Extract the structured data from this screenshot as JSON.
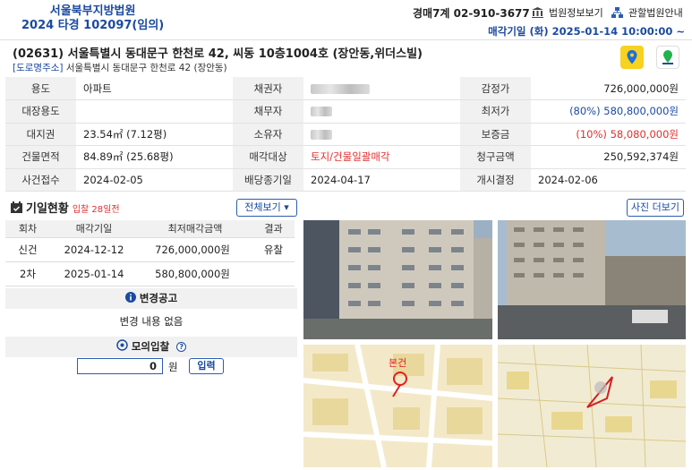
{
  "header": {
    "court_name": "서울북부지방법원",
    "case_no": "2024 타경 102097(임의)",
    "phone": "경매7계 02-910-3677",
    "court_info_label": "법원정보보기",
    "jurisdiction_label": "관할법원안내",
    "sale_date": "매각기일 (화) 2025-01-14 10:00:00 ~"
  },
  "address": {
    "main": "(02631) 서울특별시 동대문구 한천로 42, 씨동 10층1004호 (장안동,위더스빌)",
    "road_tag": "[도로명주소]",
    "road": "서울특별시 동대문구 한천로 42 (장안동)"
  },
  "info": {
    "labels": [
      "용도",
      "채권자",
      "감정가",
      "대장용도",
      "채무자",
      "최저가",
      "대지권",
      "소유자",
      "보증금",
      "건물면적",
      "매각대상",
      "청구금액",
      "사건접수",
      "배당종기일",
      "개시결정"
    ],
    "usage": "아파트",
    "appraisal": "726,000,000원",
    "min_price": "(80%) 580,800,000원",
    "land_right": "23.54㎡ (7.12평)",
    "deposit": "(10%) 58,080,000원",
    "building_area": "84.89㎡ (25.68평)",
    "sale_target": "토지/건물일괄매각",
    "claim": "250,592,374원",
    "received": "2024-02-05",
    "dividend_deadline": "2024-04-17",
    "start_decision": "2024-02-06"
  },
  "history": {
    "title": "기일현황",
    "subtitle": "입찰 28일전",
    "view_all": "전체보기 ▾",
    "columns": [
      "회차",
      "매각기일",
      "최저매각금액",
      "결과"
    ],
    "rows": [
      {
        "round": "신건",
        "date": "2024-12-12",
        "price": "726,000,000원",
        "result": "유찰"
      },
      {
        "round": "2차",
        "date": "2025-01-14",
        "price": "580,800,000원",
        "result": ""
      }
    ]
  },
  "notice": {
    "title": "변경공고",
    "content": "변경 내용 없음"
  },
  "mock_bid": {
    "title": "모의입찰",
    "value": "0",
    "unit": "원",
    "submit": "입력"
  },
  "photos": {
    "more": "사진 더보기",
    "map_label": "본건"
  }
}
